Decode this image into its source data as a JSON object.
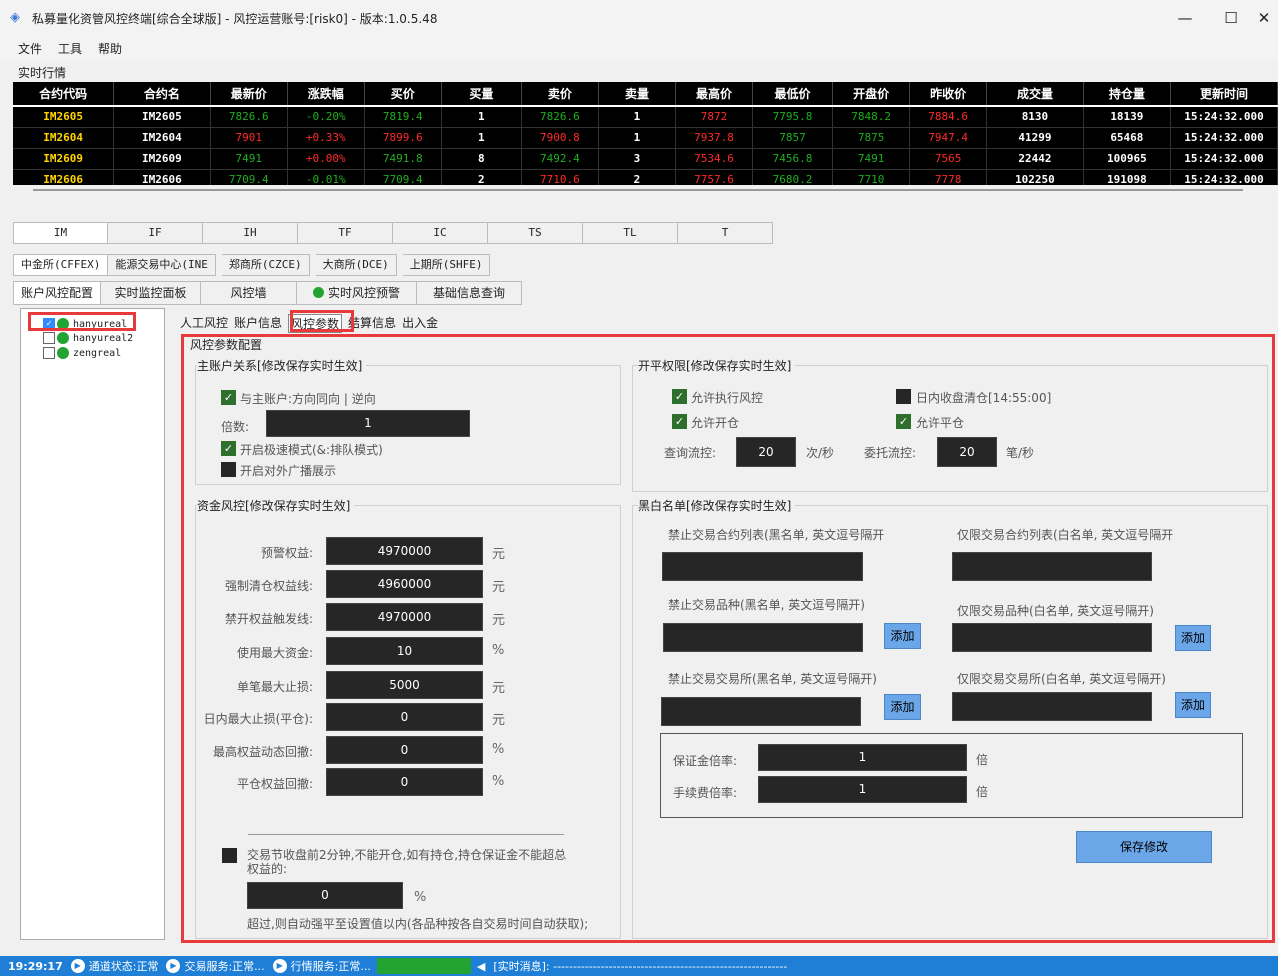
{
  "window": {
    "title": "私募量化资管风控终端[综合全球版] - 风控运营账号:[risk0] - 版本:1.0.5.48",
    "minimize": "—",
    "maximize": "☐",
    "close": "✕"
  },
  "menu": {
    "file": "文件",
    "tools": "工具",
    "help": "帮助"
  },
  "market": {
    "group_label": "实时行情",
    "headers": [
      "合约代码",
      "合约名",
      "最新价",
      "涨跌幅",
      "买价",
      "买量",
      "卖价",
      "卖量",
      "最高价",
      "最低价",
      "开盘价",
      "昨收价",
      "成交量",
      "持仓量",
      "更新时间"
    ],
    "rows": [
      [
        "IM2605",
        "IM2605",
        "7826.6",
        "-0.20%",
        "7819.4",
        "1",
        "7826.6",
        "1",
        "7872",
        "7795.8",
        "7848.2",
        "7884.6",
        "8130",
        "18139",
        "15:24:32.000"
      ],
      [
        "IM2604",
        "IM2604",
        "7901",
        "+0.33%",
        "7899.6",
        "1",
        "7900.8",
        "1",
        "7937.8",
        "7857",
        "7875",
        "7947.4",
        "41299",
        "65468",
        "15:24:32.000"
      ],
      [
        "IM2609",
        "IM2609",
        "7491",
        "+0.00%",
        "7491.8",
        "8",
        "7492.4",
        "3",
        "7534.6",
        "7456.8",
        "7491",
        "7565",
        "22442",
        "100965",
        "15:24:32.000"
      ],
      [
        "IM2606",
        "IM2606",
        "7709.4",
        "-0.01%",
        "7709.4",
        "2",
        "7710.6",
        "2",
        "7757.6",
        "7680.2",
        "7710",
        "7778",
        "102250",
        "191098",
        "15:24:32.000"
      ]
    ]
  },
  "product_tabs": [
    "IM",
    "IF",
    "IH",
    "TF",
    "IC",
    "TS",
    "TL",
    "T"
  ],
  "exchange_tabs": [
    "中金所(CFFEX)",
    "能源交易中心(INE",
    "郑商所(CZCE)",
    "大商所(DCE)",
    "上期所(SHFE)"
  ],
  "main_tabs": [
    "账户风控配置",
    "实时监控面板",
    "风控墙",
    "实时风控预警",
    "基础信息查询"
  ],
  "accounts": [
    "hanyureal",
    "hanyureal2",
    "zengreal"
  ],
  "sub_tabs": [
    "人工风控",
    "账户信息",
    "风控参数",
    "结算信息",
    "出入金"
  ],
  "config_title": "风控参数配置",
  "main_account": {
    "title": "主账户关系[修改保存实时生效]",
    "same_direction": "与主账户:方向同向 | 逆向",
    "multiplier_label": "倍数:",
    "multiplier_value": "1",
    "fast_mode": "开启极速模式(&:排队模式)",
    "broadcast": "开启对外广播展示"
  },
  "permissions": {
    "title": "开平权限[修改保存实时生效]",
    "allow_risk": "允许执行风控",
    "close_at_end": "日内收盘清仓[14:55:00]",
    "allow_open": "允许开仓",
    "allow_close": "允许平仓",
    "query_flow_label": "查询流控:",
    "query_flow_value": "20",
    "query_flow_unit": "次/秒",
    "order_flow_label": "委托流控:",
    "order_flow_value": "20",
    "order_flow_unit": "笔/秒"
  },
  "capital": {
    "title": "资金风控[修改保存实时生效]",
    "fields": [
      {
        "label": "预警权益:",
        "value": "4970000",
        "unit": "元"
      },
      {
        "label": "强制清仓权益线:",
        "value": "4960000",
        "unit": "元"
      },
      {
        "label": "禁开权益触发线:",
        "value": "4970000",
        "unit": "元"
      },
      {
        "label": "使用最大资金:",
        "value": "10",
        "unit": "%"
      },
      {
        "label": "单笔最大止损:",
        "value": "5000",
        "unit": "元"
      },
      {
        "label": "日内最大止损(平仓):",
        "value": "0",
        "unit": "元"
      },
      {
        "label": "最高权益动态回撤:",
        "value": "0",
        "unit": "%"
      },
      {
        "label": "平仓权益回撤:",
        "value": "0",
        "unit": "%"
      }
    ],
    "close_rule": "交易节收盘前2分钟,不能开仓,如有持仓,持仓保证金不能超总权益的:",
    "close_rule_value": "0",
    "close_rule_unit": "%",
    "close_rule_note": "超过,则自动强平至设置值以内(各品种按各自交易时间自动获取);"
  },
  "blacklist": {
    "title": "黑白名单[修改保存实时生效]",
    "ban_contracts": "禁止交易合约列表(黑名单, 英文逗号隔开",
    "only_contracts": "仅限交易合约列表(白名单, 英文逗号隔开",
    "ban_products": "禁止交易品种(黑名单, 英文逗号隔开)",
    "only_products": "仅限交易品种(白名单, 英文逗号隔开)",
    "ban_exchanges": "禁止交易交易所(黑名单, 英文逗号隔开)",
    "only_exchanges": "仅限交易交易所(白名单, 英文逗号隔开)",
    "add": "添加",
    "margin_label": "保证金倍率:",
    "margin_value": "1",
    "margin_unit": "倍",
    "fee_label": "手续费倍率:",
    "fee_value": "1",
    "fee_unit": "倍",
    "save": "保存修改"
  },
  "statusbar": {
    "time": "19:29:17",
    "channel": "通道状态:正常",
    "trade": "交易服务:正常...",
    "quote": "行情服务:正常...",
    "msg": "[实时消息]: -----------------------------------------------------------"
  },
  "colors": {
    "accent": "#1f7fd6",
    "highlight": "#e83a3a",
    "up": "#ff2a2a",
    "down": "#1fae1f"
  }
}
